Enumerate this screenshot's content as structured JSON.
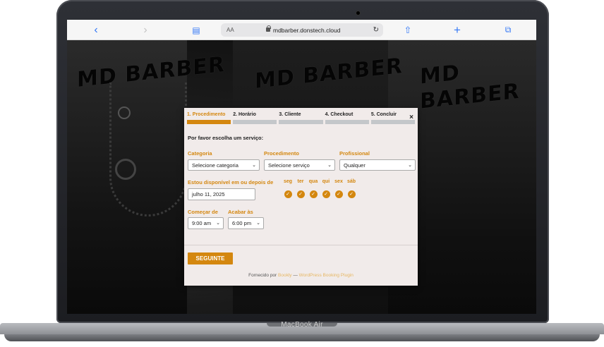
{
  "device": {
    "label": "MacBook Air"
  },
  "browser": {
    "text_size": "AA",
    "url": "mdbarber.donstech.cloud",
    "icons": [
      "back-icon",
      "forward-icon",
      "bookmarks-icon",
      "lock-icon",
      "reload-icon",
      "share-icon",
      "new-tab-icon",
      "tabs-icon"
    ]
  },
  "background": {
    "sign_text": "MD BARBER"
  },
  "booking": {
    "steps": [
      {
        "label": "1. Procedimento"
      },
      {
        "label": "2. Horário"
      },
      {
        "label": "3. Cliente"
      },
      {
        "label": "4. Checkout"
      },
      {
        "label": "5. Concluir"
      }
    ],
    "active_step": 1,
    "close_symbol": "×",
    "prompt": "Por favor escolha um serviço:",
    "category": {
      "label": "Categoria",
      "value": "Selecione categoria"
    },
    "service": {
      "label": "Procedimento",
      "value": "Selecione serviço"
    },
    "staff": {
      "label": "Profissional",
      "value": "Qualquer"
    },
    "date": {
      "label": "Estou disponível em ou depois de",
      "value": "julho 11, 2025"
    },
    "days": [
      "seg",
      "ter",
      "qua",
      "qui",
      "sex",
      "sáb"
    ],
    "start": {
      "label": "Começar de",
      "value": "9:00 am"
    },
    "end": {
      "label": "Acabar às",
      "value": "6:00 pm"
    },
    "next_button": "SEGUINTE",
    "footer": {
      "prefix": "Fornecido por",
      "plugin": "Bookly",
      "separator": "—",
      "plugin_desc": "WordPress Booking Plugin"
    }
  },
  "colors": {
    "accent": "#d4870f",
    "step_inactive": "#c4c7ca",
    "modal_bg": "#f1ebea"
  }
}
